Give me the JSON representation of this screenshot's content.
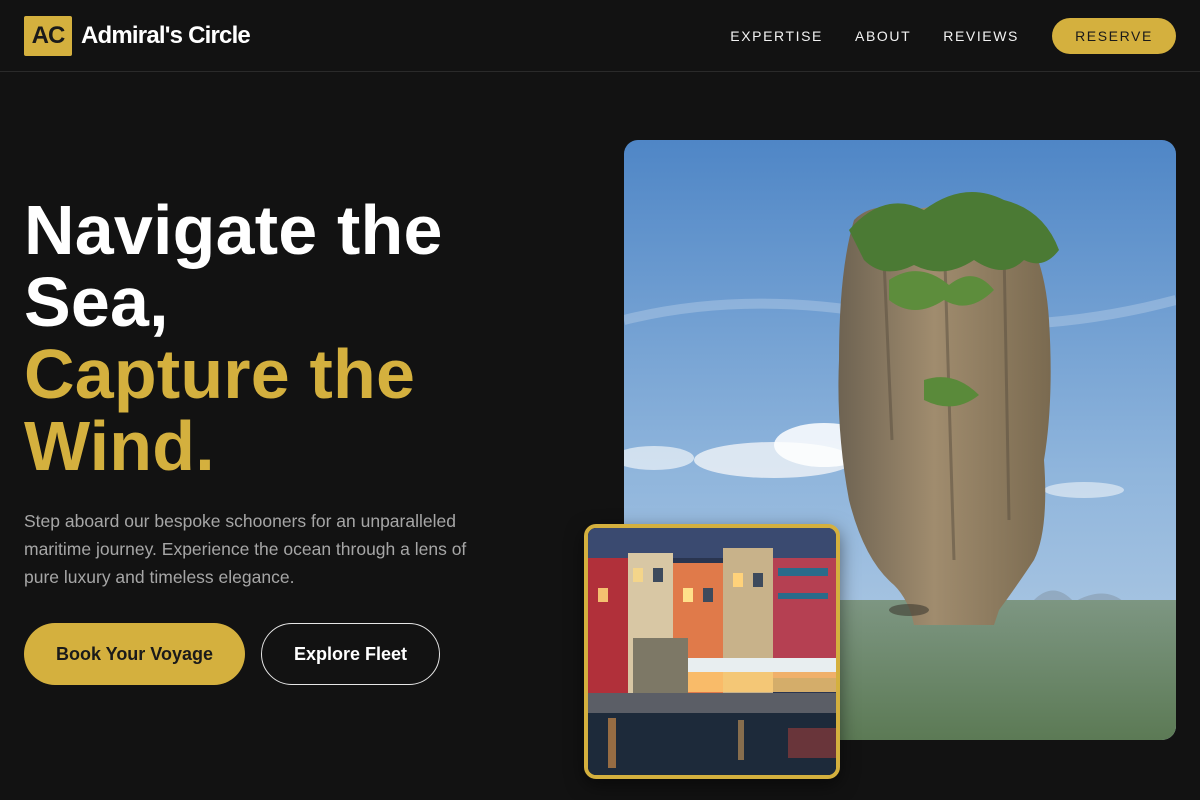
{
  "brand": {
    "logo_text": "AC",
    "name": "Admiral's Circle"
  },
  "nav": {
    "links": [
      "EXPERTISE",
      "ABOUT",
      "REVIEWS"
    ],
    "reserve_label": "RESERVE"
  },
  "hero": {
    "title_line1": "Navigate the",
    "title_line2": "Sea,",
    "title_line3": "Capture the",
    "title_line4": "Wind.",
    "description": "Step aboard our bespoke schooners for an unparalleled maritime journey. Experience the ocean through a lens of pure luxury and timeless elegance.",
    "primary_cta": "Book Your Voyage",
    "secondary_cta": "Explore Fleet"
  },
  "images": {
    "main": "limestone-sea-stack-photo",
    "inset": "colorful-waterfront-village-photo"
  },
  "colors": {
    "background": "#121212",
    "accent_gold": "#d4b03e",
    "text_muted": "#a6a6a6"
  }
}
